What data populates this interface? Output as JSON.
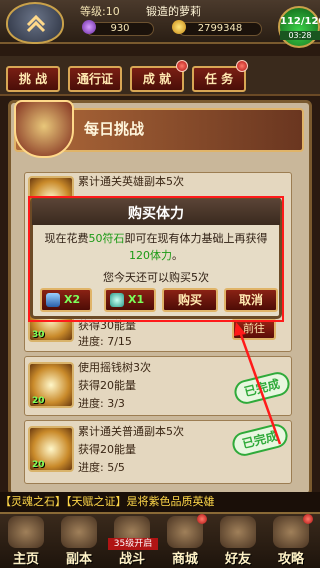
{
  "topbar": {
    "level": "等级:10",
    "player_name": "锻造的萝莉",
    "gems": "930",
    "gold": "2799348",
    "stamina": "112/120",
    "stamina_timer": "03:28"
  },
  "tabs": [
    {
      "label": "挑 战"
    },
    {
      "label": "通行证"
    },
    {
      "label": "成 就"
    },
    {
      "label": "任 务"
    }
  ],
  "panel": {
    "title": "每日挑战"
  },
  "tasks": [
    {
      "title": "累计通关英雄副本5次",
      "reward": "获得30能量",
      "progress": "进度: 7/15",
      "reward_num": "30"
    },
    {
      "title": "使用摇钱树3次",
      "reward": "获得20能量",
      "progress": "进度: 3/3",
      "reward_num": "20",
      "status": "已完成"
    },
    {
      "title": "累计通关普通副本5次",
      "reward": "获得20能量",
      "progress": "进度: 5/5",
      "reward_num": "20",
      "status": "已完成"
    }
  ],
  "goto_label": "前往",
  "dialog": {
    "title": "购买体力",
    "body_pre": "现在花费",
    "cost": "50符石",
    "body_mid": "即可在现有体力基础上再获得",
    "gain": "120体力",
    "body_end": "。",
    "note": "您今天还可以购买5次",
    "item1": "X2",
    "item2": "X1",
    "buy": "购买",
    "cancel": "取消"
  },
  "ticker": "【灵魂之石】【天赋之证】是将紫色品质英雄",
  "nav": [
    {
      "label": "主页"
    },
    {
      "label": "副本"
    },
    {
      "label": "战斗",
      "badge": "35级开启"
    },
    {
      "label": "商城"
    },
    {
      "label": "好友"
    },
    {
      "label": "攻略"
    }
  ],
  "colors": {
    "accent_gold": "#e0b468",
    "button_red": "#8a2214",
    "complete_green": "#2faa3a",
    "highlight_red": "#ff1a1a"
  }
}
